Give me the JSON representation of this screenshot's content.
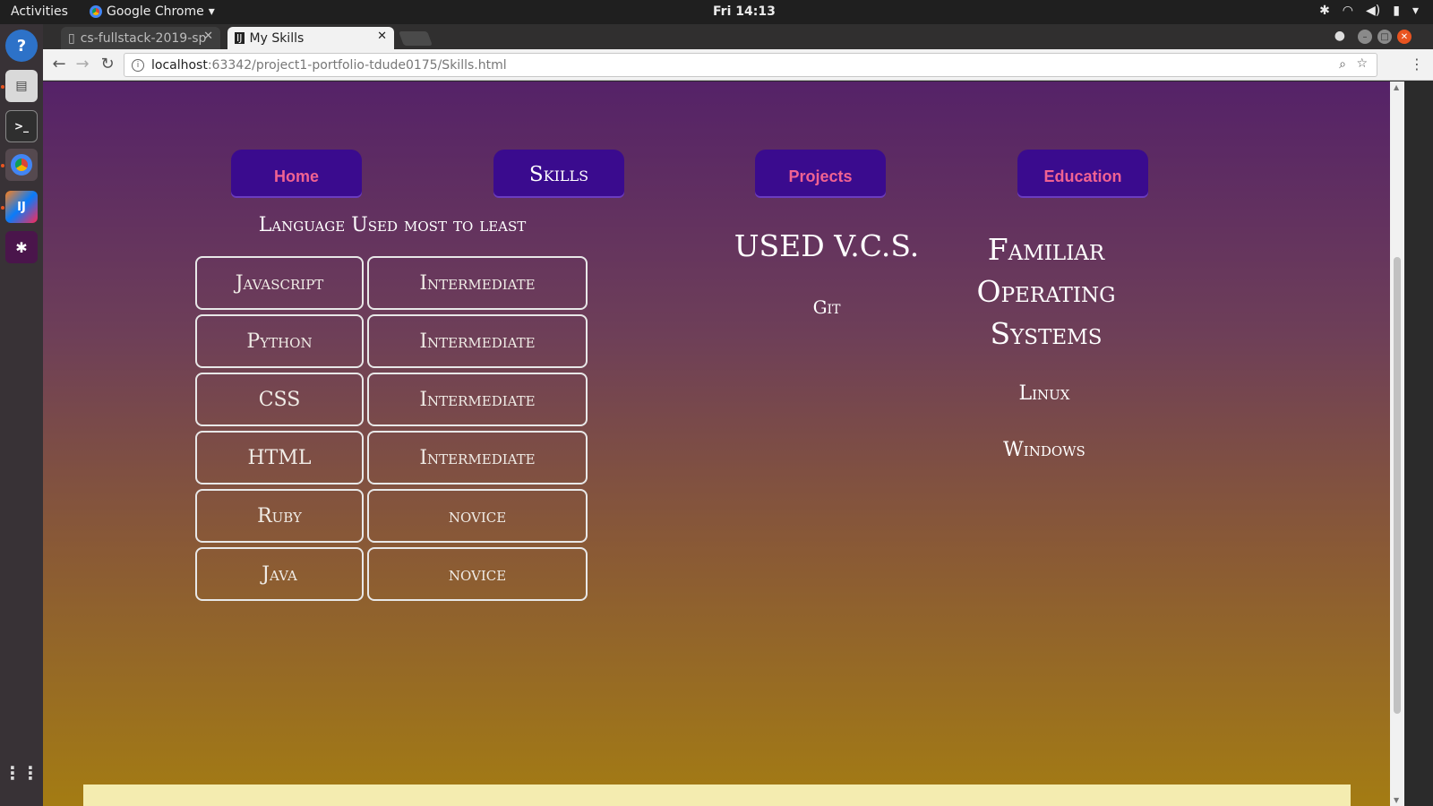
{
  "topbar": {
    "activities": "Activities",
    "app_name": "Google Chrome",
    "clock": "Fri 14:13"
  },
  "browser": {
    "tabs": [
      {
        "title": "cs-fullstack-2019-sp",
        "active": false
      },
      {
        "title": "My Skills",
        "active": true
      }
    ],
    "url_host": "localhost",
    "url_path": ":63342/project1-portfolio-tdude0175/Skills.html"
  },
  "page": {
    "nav": [
      {
        "label": "Home",
        "current": false
      },
      {
        "label": "Skills",
        "current": true
      },
      {
        "label": "Projects",
        "current": false
      },
      {
        "label": "Education",
        "current": false
      }
    ],
    "languages": {
      "heading": "Language Used most to least",
      "rows": [
        {
          "language": "Javascript",
          "level": "Intermediate"
        },
        {
          "language": "Python",
          "level": "Intermediate"
        },
        {
          "language": "CSS",
          "level": "Intermediate"
        },
        {
          "language": "HTML",
          "level": "Intermediate"
        },
        {
          "language": "Ruby",
          "level": "novice"
        },
        {
          "language": "Java",
          "level": "novice"
        }
      ]
    },
    "vcs": {
      "heading": "USED V.C.S.",
      "items": [
        "Git"
      ]
    },
    "os": {
      "heading_lines": [
        "Familiar",
        "Operating",
        "Systems"
      ],
      "items": [
        "Linux",
        "Windows"
      ]
    }
  },
  "colors": {
    "nav_button_bg": "#3a0b8e",
    "nav_label_pink": "#f06292",
    "gradient_top": "#552268",
    "gradient_bottom": "#a47c13"
  }
}
